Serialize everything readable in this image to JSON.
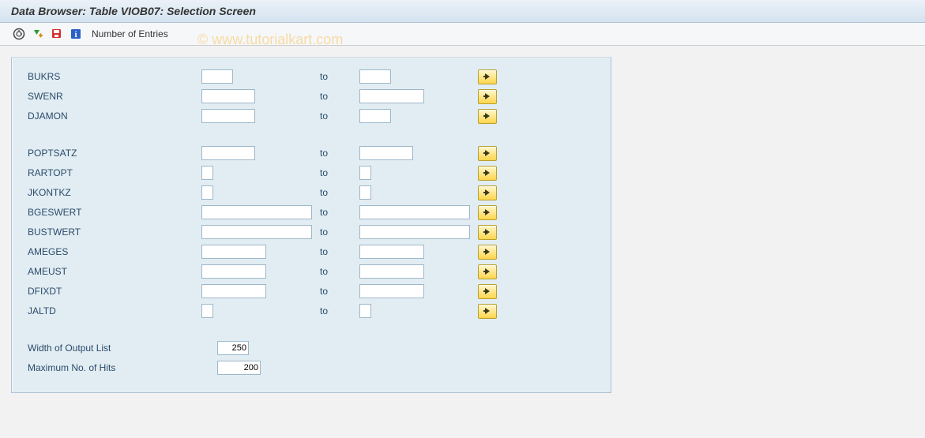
{
  "title": "Data Browser: Table VIOB07: Selection Screen",
  "watermark": "© www.tutorialkart.com",
  "toolbar": {
    "execute_icon": "execute",
    "execute_plus_icon": "execute-plus",
    "save_icon": "save-variant",
    "info_icon": "info",
    "entries_label": "Number of Entries"
  },
  "to_label": "to",
  "fields_group1": [
    {
      "name": "BUKRS",
      "size": "w-small",
      "from": "",
      "to": ""
    },
    {
      "name": "SWENR",
      "size": "w-med",
      "to_size": "w-med2",
      "from": "",
      "to": ""
    },
    {
      "name": "DJAMON",
      "size": "w-med",
      "to_size": "w-small",
      "from": "",
      "to": ""
    }
  ],
  "fields_group2": [
    {
      "name": "POPTSATZ",
      "size": "w-med",
      "from": "",
      "to": ""
    },
    {
      "name": "RARTOPT",
      "size": "w-tiny",
      "from": "",
      "to": ""
    },
    {
      "name": "JKONTKZ",
      "size": "w-tiny",
      "from": "",
      "to": ""
    },
    {
      "name": "BGESWERT",
      "size": "w-large",
      "from": "",
      "to": ""
    },
    {
      "name": "BUSTWERT",
      "size": "w-large",
      "from": "",
      "to": ""
    },
    {
      "name": "AMEGES",
      "size": "w-med2",
      "from": "",
      "to": ""
    },
    {
      "name": "AMEUST",
      "size": "w-med2",
      "from": "",
      "to": ""
    },
    {
      "name": "DFIXDT",
      "size": "w-med2",
      "from": "",
      "to": ""
    },
    {
      "name": "JALTD",
      "size": "w-tiny",
      "from": "",
      "to": ""
    }
  ],
  "output_settings": {
    "width_label": "Width of Output List",
    "width_value": "250",
    "maxhits_label": "Maximum No. of Hits",
    "maxhits_value": "200"
  }
}
